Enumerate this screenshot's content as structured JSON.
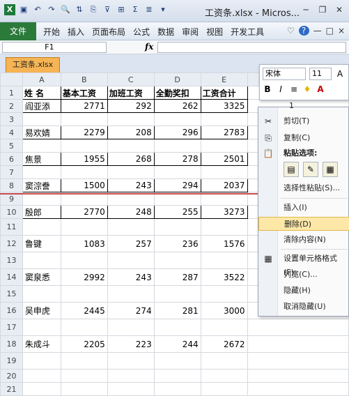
{
  "window": {
    "title": "工资条.xlsx - Micros...",
    "qat_icons": [
      "save-icon",
      "undo-icon",
      "redo-icon",
      "print-preview-icon",
      "sort-icon",
      "copy-format-icon",
      "filter-icon",
      "borders-icon",
      "sum-icon",
      "align-icon",
      "dropdown-icon"
    ],
    "controls": [
      "minimize",
      "restore",
      "close"
    ]
  },
  "ribbon": {
    "file_label": "文件",
    "tabs": [
      "开始",
      "插入",
      "页面布局",
      "公式",
      "数据",
      "审阅",
      "视图",
      "开发工具"
    ],
    "right_glyphs": [
      "♡",
      "?",
      "—",
      "□",
      "×"
    ]
  },
  "formula_bar": {
    "name_box": "F1",
    "fx": "fx",
    "formula": ""
  },
  "doc_tab": {
    "label": "工资条.xlsx"
  },
  "sheet": {
    "columns": [
      "A",
      "B",
      "C",
      "D",
      "E"
    ],
    "rows": [
      {
        "n": "1",
        "cells": [
          "姓  名",
          "基本工资",
          "加班工资",
          "全勤奖扣",
          "工资合计"
        ],
        "header": true
      },
      {
        "n": "2",
        "cells": [
          "阎亚添",
          "2771",
          "292",
          "262",
          "3325"
        ]
      },
      {
        "n": "3",
        "cells": [
          "",
          "",
          "",
          "",
          ""
        ]
      },
      {
        "n": "4",
        "cells": [
          "易欢婧",
          "2279",
          "208",
          "296",
          "2783"
        ]
      },
      {
        "n": "5",
        "cells": [
          "",
          "",
          "",
          "",
          ""
        ]
      },
      {
        "n": "6",
        "cells": [
          "焦景",
          "1955",
          "268",
          "278",
          "2501"
        ]
      },
      {
        "n": "7",
        "cells": [
          "",
          "",
          "",
          "",
          ""
        ]
      },
      {
        "n": "8",
        "cells": [
          "窦淙誊",
          "1500",
          "243",
          "294",
          "2037"
        ]
      },
      {
        "n": "9",
        "cells": [
          "",
          "",
          "",
          "",
          ""
        ]
      },
      {
        "n": "10",
        "cells": [
          "殷郎",
          "2770",
          "248",
          "255",
          "3273"
        ]
      },
      {
        "n": "11",
        "cells": [
          "",
          "",
          "",
          "",
          ""
        ]
      },
      {
        "n": "12",
        "cells": [
          "鲁键",
          "1083",
          "257",
          "236",
          "1576"
        ]
      },
      {
        "n": "13",
        "cells": [
          "",
          "",
          "",
          "",
          ""
        ]
      },
      {
        "n": "14",
        "cells": [
          "窦泉悉",
          "2992",
          "243",
          "287",
          "3522"
        ]
      },
      {
        "n": "15",
        "cells": [
          "",
          "",
          "",
          "",
          ""
        ]
      },
      {
        "n": "16",
        "cells": [
          "吴申虎",
          "2445",
          "274",
          "281",
          "3000"
        ]
      },
      {
        "n": "17",
        "cells": [
          "",
          "",
          "",
          "",
          ""
        ]
      },
      {
        "n": "18",
        "cells": [
          "朱成斗",
          "2205",
          "223",
          "244",
          "2672"
        ]
      },
      {
        "n": "19",
        "cells": [
          "",
          "",
          "",
          "",
          ""
        ]
      },
      {
        "n": "20",
        "cells": [
          "",
          "",
          "",
          "",
          ""
        ]
      },
      {
        "n": "21",
        "cells": [
          "",
          "",
          "",
          "",
          ""
        ]
      }
    ]
  },
  "mini_toolbar": {
    "font": "宋体",
    "size": "11",
    "row1_icons": [
      "A+",
      "A-"
    ],
    "row2_icons": [
      "B",
      "I",
      "≡",
      "♦",
      "A"
    ]
  },
  "context_menu": {
    "active_cell_value": "1",
    "cut": "剪切(T)",
    "copy": "复制(C)",
    "paste_options": "粘贴选项:",
    "paste_special": "选择性粘贴(S)...",
    "insert": "插入(I)",
    "delete": "删除(D)",
    "clear": "清除内容(N)",
    "format_cells": "设置单元格格式(F)...",
    "col_width": "列宽(C)...",
    "hide": "隐藏(H)",
    "unhide": "取消隐藏(U)"
  }
}
